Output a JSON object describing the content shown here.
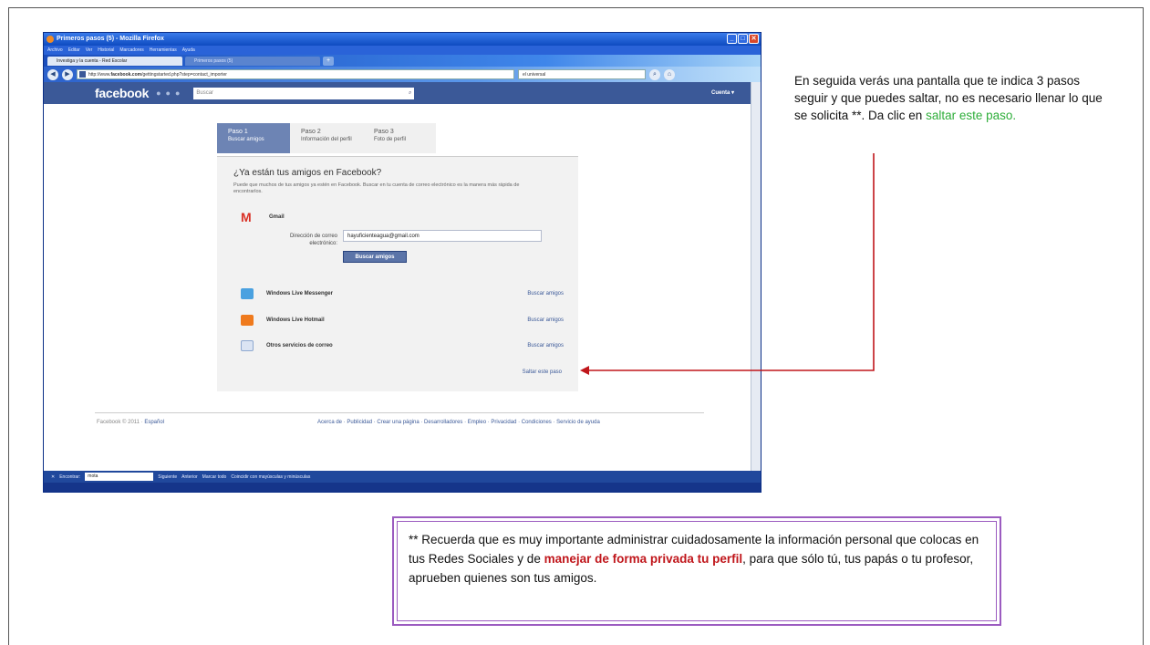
{
  "window": {
    "title": "Primeros pasos (5) - Mozilla Firefox",
    "menus": [
      "Archivo",
      "Editar",
      "Ver",
      "Historial",
      "Marcadores",
      "Herramientas",
      "Ayuda"
    ],
    "tabs": [
      {
        "label": "Investiga y la cuenta - Red Escolar"
      },
      {
        "label": "Primeros pasos (5)"
      }
    ],
    "url_prefix": "http://www.",
    "url_host": "facebook.com",
    "url_path": "/gettingstarted.php?step=contact_importer",
    "search_value": "el universal",
    "find_label": "Encontrar:",
    "find_value": "mota",
    "find_next": "Siguiente",
    "find_prev": "Anterior",
    "find_highlight": "Marcar todo",
    "find_match_case": "Coincidir con mayúsculas y minúsculas"
  },
  "facebook": {
    "logo": "facebook",
    "search_placeholder": "Buscar",
    "account": "Cuenta ▾",
    "steps": [
      {
        "title": "Paso 1",
        "subtitle": "Buscar amigos"
      },
      {
        "title": "Paso 2",
        "subtitle": "Información del perfil"
      },
      {
        "title": "Paso 3",
        "subtitle": "Foto de perfil"
      }
    ],
    "heading": "¿Ya están tus amigos en Facebook?",
    "description": "Puede que muchos de tus amigos ya estén en Facebook. Buscar en tu cuenta de correo electrónico es la manera más rápida de encontrarlos.",
    "gmail_label": "Gmail",
    "email_label": "Dirección de correo electrónico:",
    "email_value": "hayuficienteagua@gmail.com",
    "find_button": "Buscar amigos",
    "services": [
      {
        "name": "Windows Live Messenger",
        "link": "Buscar amigos",
        "color": "#4aa1e0"
      },
      {
        "name": "Windows Live Hotmail",
        "link": "Buscar amigos",
        "color": "#ef7a1d"
      },
      {
        "name": "Otros servicios de correo",
        "link": "Buscar amigos",
        "color": "#8ea8d0"
      }
    ],
    "skip_link": "Saltar este paso",
    "footer_copy": "Facebook © 2011 ·",
    "footer_lang": "Español",
    "footer_links": "Acerca de · Publicidad · Crear una página · Desarrolladores · Empleo · Privacidad · Condiciones · Servicio de ayuda"
  },
  "annotation": {
    "text": "En seguida verás una pantalla que te indica 3 pasos  seguir y que puedes saltar, no es necesario llenar lo que se solicita **. Da clic en",
    "highlight": "saltar este paso.",
    "arrow_color": "#c0161b"
  },
  "warning": {
    "text_before": "** Recuerda que es muy importante administrar cuidadosamente  la información personal que colocas en tus Redes Sociales y de",
    "highlight": "manejar de forma privada tu perfil",
    "text_after": ", para que sólo tú, tus papás o tu profesor, aprueben quienes son tus amigos.",
    "border_color": "#9b5bc0"
  }
}
